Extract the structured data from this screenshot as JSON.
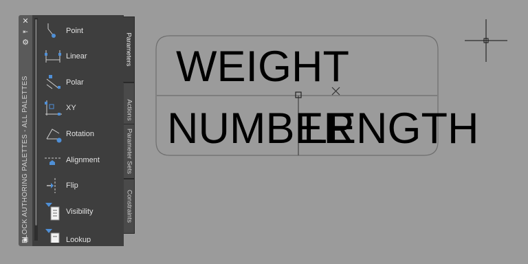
{
  "palette": {
    "title": "BLOCK AUTHORING PALETTES - ALL PALETTES",
    "titlebar_icons": [
      "close-icon",
      "autohide-icon",
      "properties-icon"
    ],
    "tools": [
      {
        "label": "Point",
        "icon": "point-parameter-icon"
      },
      {
        "label": "Linear",
        "icon": "linear-parameter-icon"
      },
      {
        "label": "Polar",
        "icon": "polar-parameter-icon"
      },
      {
        "label": "XY",
        "icon": "xy-parameter-icon"
      },
      {
        "label": "Rotation",
        "icon": "rotation-parameter-icon"
      },
      {
        "label": "Alignment",
        "icon": "alignment-parameter-icon"
      },
      {
        "label": "Flip",
        "icon": "flip-parameter-icon"
      },
      {
        "label": "Visibility",
        "icon": "visibility-parameter-icon"
      },
      {
        "label": "Lookup",
        "icon": "lookup-parameter-icon"
      }
    ],
    "tabs": [
      {
        "label": "Parameters",
        "active": true
      },
      {
        "label": "Actions",
        "active": false
      },
      {
        "label": "Parameter Sets",
        "active": false
      },
      {
        "label": "Constraints",
        "active": false
      }
    ]
  },
  "drawing": {
    "attributes": [
      "WEIGHT",
      "NUMBER",
      "LENGTH"
    ],
    "background": "#9b9b9b",
    "line_color": "#6e6e6e"
  }
}
